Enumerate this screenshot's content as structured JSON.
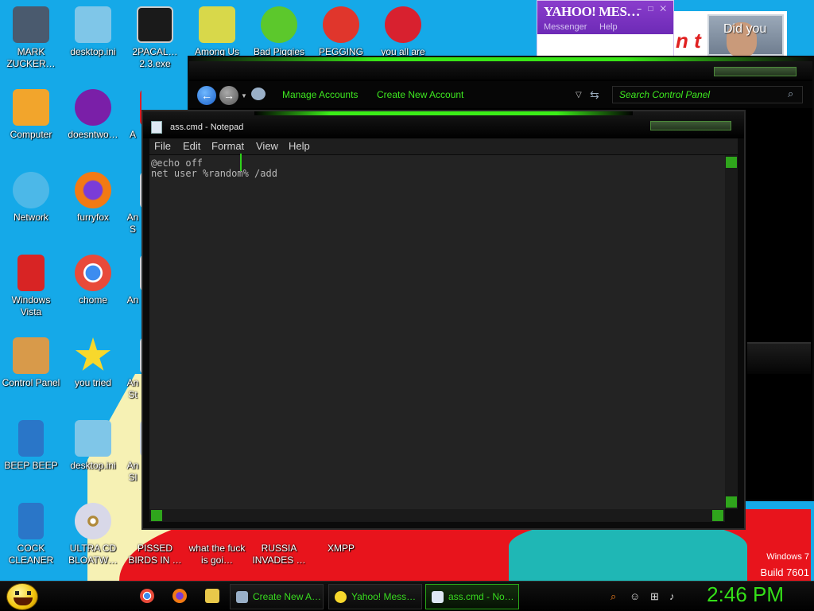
{
  "desktop": {
    "icons": [
      {
        "label": "MARK ZUCKER…",
        "icon": "zuckerberg-icon",
        "color": "#4a5a6e"
      },
      {
        "label": "desktop.ini",
        "icon": "ini-file-icon",
        "color": "#7fc6e8"
      },
      {
        "label": "2PACAL… 2.3.exe",
        "icon": "console-exe-icon",
        "color": "#1a1a1a"
      },
      {
        "label": "Among Us",
        "icon": "among-us-icon",
        "color": "#d8d84a"
      },
      {
        "label": "Bad Piggies",
        "icon": "bad-piggies-icon",
        "color": "#5cc82c"
      },
      {
        "label": "PEGGING",
        "icon": "pegging-icon",
        "color": "#e0362c"
      },
      {
        "label": "you all are",
        "icon": "dev-cpp-icon",
        "color": "#d8212f"
      },
      {
        "label": "Computer",
        "icon": "computer-icon",
        "color": "#f2a52c"
      },
      {
        "label": "doesntwo…",
        "icon": "yahoo-messenger-icon",
        "color": "#7a1fa8"
      },
      {
        "label": "A",
        "icon": "angry-birds-icon",
        "color": "#d8202a"
      },
      {
        "label": "Network",
        "icon": "network-icon",
        "color": "#4cb8e8"
      },
      {
        "label": "furryfox",
        "icon": "firefox-icon",
        "color": "#f27a14"
      },
      {
        "label": "An S",
        "icon": "generic-app-icon",
        "color": "#cfd8e0"
      },
      {
        "label": "Windows Vista",
        "icon": "recycle-bin-icon",
        "color": "#d82424"
      },
      {
        "label": "chome",
        "icon": "chrome-icon",
        "color": "#3c8cf0"
      },
      {
        "label": "An",
        "icon": "generic-app-icon",
        "color": "#cfd8e0"
      },
      {
        "label": "Control Panel",
        "icon": "control-panel-icon",
        "color": "#d89a4a"
      },
      {
        "label": "you tried",
        "icon": "gold-star-icon",
        "color": "#f7d82c"
      },
      {
        "label": "An St",
        "icon": "generic-app-icon",
        "color": "#cfd8e0"
      },
      {
        "label": "BEEP BEEP",
        "icon": "blue-file-icon",
        "color": "#2a76c8"
      },
      {
        "label": "desktop.ini",
        "icon": "ini-file-icon",
        "color": "#7fc6e8"
      },
      {
        "label": "An Sl",
        "icon": "generic-app-icon",
        "color": "#cfd8e0"
      },
      {
        "label": "COCK CLEANER",
        "icon": "blue-file-icon",
        "color": "#2a76c8"
      },
      {
        "label": "ULTRA CD BLOATW…",
        "icon": "cd-disc-icon",
        "color": "#c8c8d8"
      },
      {
        "label": "PISSED BIRDS IN …",
        "icon": "pissed-birds-icon",
        "color": "#e8e8e8"
      },
      {
        "label": "what the fuck is goi…",
        "icon": "generic-app-icon",
        "color": "#4ca8e8"
      },
      {
        "label": "RUSSIA INVADES …",
        "icon": "generic-app-icon",
        "color": "#d83030"
      },
      {
        "label": "XMPP",
        "icon": "xmpp-icon",
        "color": "#f08020"
      }
    ]
  },
  "yahoo_widget": {
    "title": "YAHOO! MES…",
    "subtitle": "Messenger",
    "help": "Help",
    "ad_text": "n t",
    "ad_caption": "Did you"
  },
  "control_panel": {
    "links": [
      "Manage Accounts",
      "Create New Account"
    ],
    "search_placeholder": "Search Control Panel"
  },
  "notepad": {
    "title": "ass.cmd - Notepad",
    "menu": [
      "File",
      "Edit",
      "Format",
      "View",
      "Help"
    ],
    "lines": [
      "@echo off",
      "net user %random% /add"
    ]
  },
  "watermark": {
    "line1": "Windows 7",
    "line2": "Build 7601"
  },
  "taskbar": {
    "buttons": [
      {
        "label": "Create New A…",
        "icon": "control-panel-users-icon",
        "active": false
      },
      {
        "label": "Yahoo! Mess…",
        "icon": "yahoo-messenger-icon",
        "active": false
      },
      {
        "label": "ass.cmd - No…",
        "icon": "notepad-icon",
        "active": true
      }
    ],
    "clock": "2:46 PM"
  },
  "colors": {
    "accent": "#38dc1f",
    "desktop": "#15a9e8",
    "window": "#0b0b0b"
  }
}
